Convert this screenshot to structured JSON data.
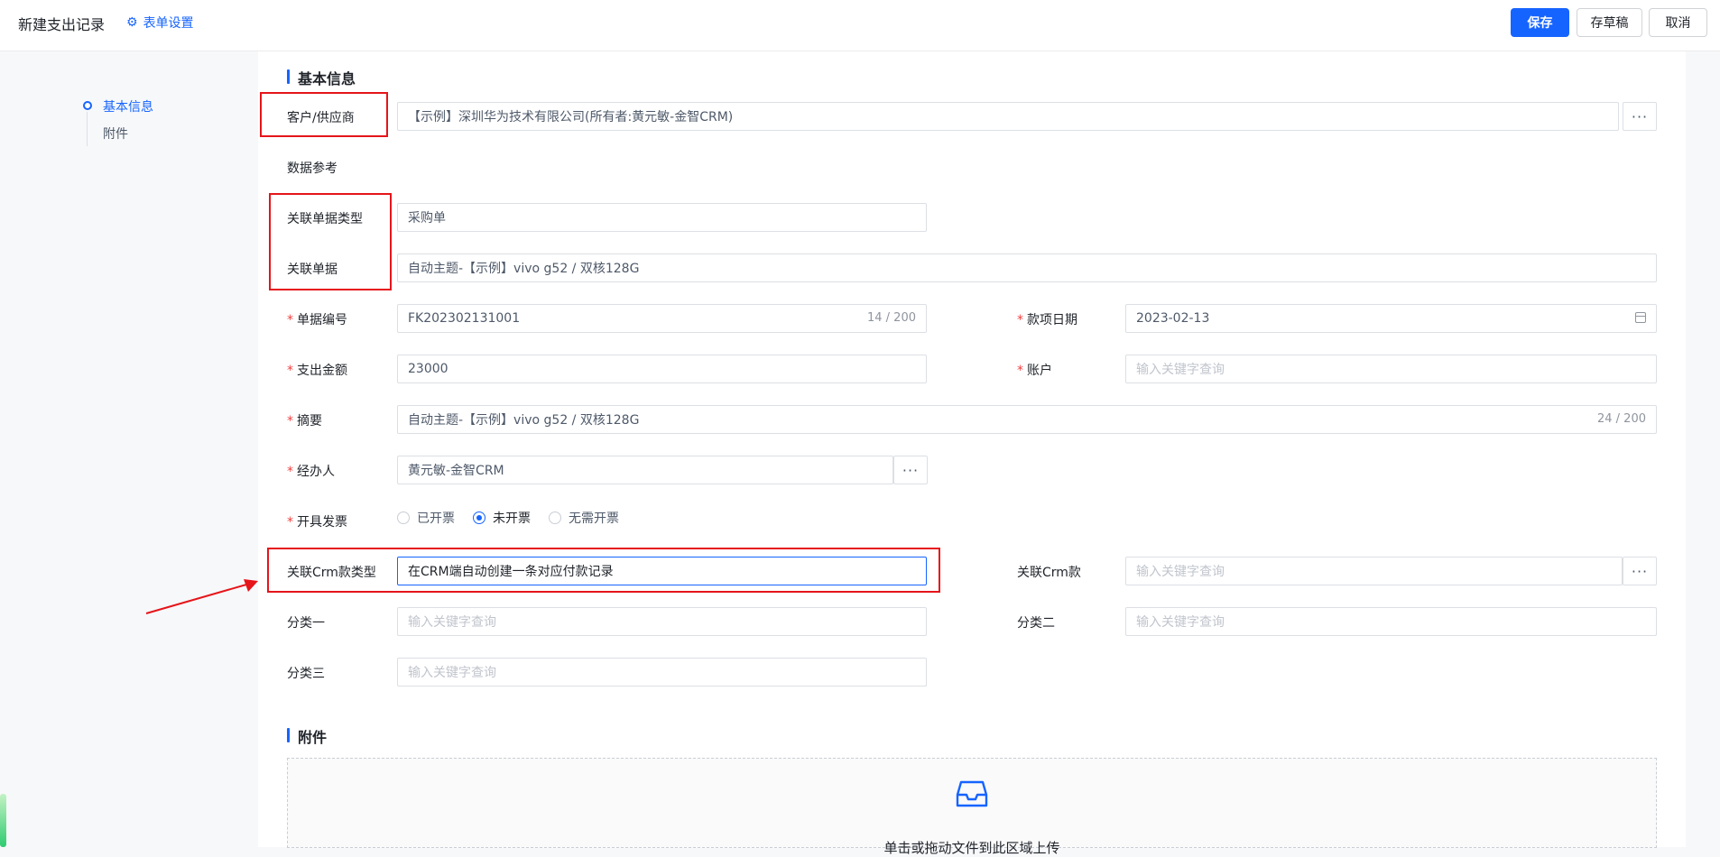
{
  "header": {
    "title": "新建支出记录",
    "form_settings": "表单设置",
    "save": "保存",
    "draft": "存草稿",
    "cancel": "取消"
  },
  "nav": {
    "items": [
      {
        "label": "基本信息",
        "active": true
      },
      {
        "label": "附件",
        "active": false
      }
    ]
  },
  "basic": {
    "section_title": "基本信息",
    "customer_label": "客户/供应商",
    "customer_value": "【示例】深圳华为技术有限公司(所有者:黄元敏-金智CRM)",
    "data_ref_label": "数据参考",
    "ref_type_label": "关联单据类型",
    "ref_type_value": "采购单",
    "ref_doc_label": "关联单据",
    "ref_doc_value": "自动主题-【示例】vivo g52 / 双核128G",
    "doc_no_label": "单据编号",
    "doc_no_value": "FK202302131001",
    "doc_no_counter": "14 / 200",
    "date_label": "款项日期",
    "date_value": "2023-02-13",
    "amount_label": "支出金额",
    "amount_value": "23000",
    "account_label": "账户",
    "account_placeholder": "输入关键字查询",
    "summary_label": "摘要",
    "summary_value": "自动主题-【示例】vivo g52 / 双核128G",
    "summary_counter": "24 / 200",
    "handler_label": "经办人",
    "handler_value": "黄元敏-金智CRM",
    "invoice_label": "开具发票",
    "invoice_options": [
      "已开票",
      "未开票",
      "无需开票"
    ],
    "invoice_selected": "未开票",
    "crm_type_label": "关联Crm款类型",
    "crm_type_value": "在CRM端自动创建一条对应付款记录",
    "crm_label": "关联Crm款",
    "crm_placeholder": "输入关键字查询",
    "cat1_label": "分类一",
    "cat1_placeholder": "输入关键字查询",
    "cat2_label": "分类二",
    "cat2_placeholder": "输入关键字查询",
    "cat3_label": "分类三",
    "cat3_placeholder": "输入关键字查询"
  },
  "attachment": {
    "section_title": "附件",
    "upload_text": "单击或拖动文件到此区域上传"
  },
  "colors": {
    "accent": "#1664ff",
    "annotation": "#e5151a"
  }
}
